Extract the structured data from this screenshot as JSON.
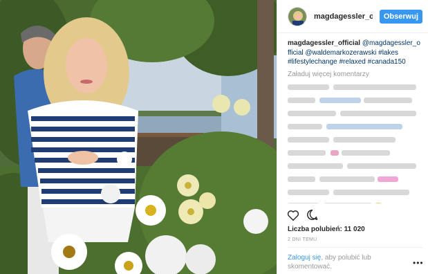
{
  "post": {
    "username": "magdagessler_official",
    "follow_label": "Obserwuj",
    "caption_user": "magdagessler_official",
    "caption_tags": [
      "@magdagessler_o",
      "fficial",
      "@waldemarkozerawski",
      "#lakes",
      "#lifestylechange",
      "#relaxed",
      "#canada150"
    ],
    "load_more": "Załaduj więcej komentarzy",
    "likes": "Liczba polubień: 11 020",
    "time_ago": "2 DNI TEMU",
    "login_link": "Zaloguj się",
    "login_text": ", aby polubić lub skomentować.",
    "more_label": "•••"
  },
  "icons": [
    "heart-icon",
    "comment-icon",
    "more-options-icon"
  ],
  "colors": {
    "accent": "#3897f0",
    "link": "#003569",
    "muted": "#999999"
  }
}
